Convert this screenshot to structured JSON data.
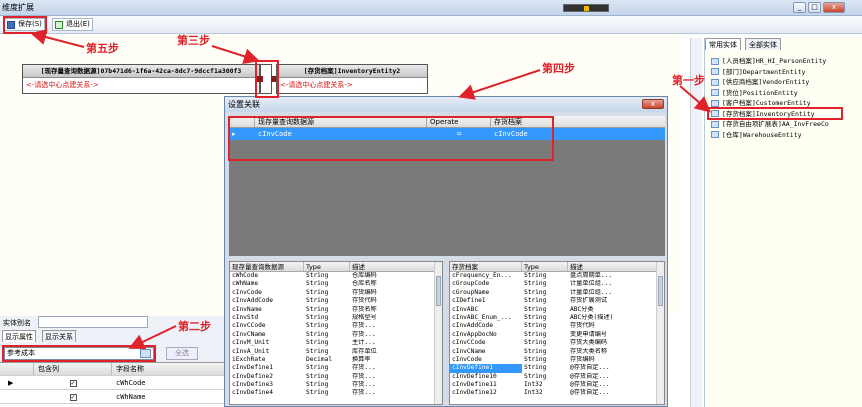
{
  "window": {
    "title": "维度扩展",
    "min": "_",
    "max": "□",
    "close": "x"
  },
  "toolbar": {
    "save_label": "保存(S)",
    "exit_label": "退出(E)"
  },
  "canvas": {
    "entity1": {
      "title": "[现存量查询数据源]07b471d6-1f6a-42ca-8dc7-9dccf1a300f3",
      "hint": "<-请选中心点建关系->"
    },
    "entity2": {
      "title": "[存货档案]InventoryEntity2",
      "hint": "<-请选中心点建关系->"
    }
  },
  "dialog": {
    "title": "设置关联",
    "close": "x",
    "relation_headers": [
      "现存量查询数据源",
      "Operate",
      "存货档案"
    ],
    "relation_row": {
      "left": "cInvCode",
      "op": "=",
      "right": "cInvCode"
    },
    "left_list": {
      "headers": [
        "现存量查询数据源",
        "Type",
        "描述"
      ],
      "rows": [
        [
          "cWhCode",
          "String",
          "仓库编码"
        ],
        [
          "cWhName",
          "String",
          "仓库名称"
        ],
        [
          "cInvCode",
          "String",
          "存货编码"
        ],
        [
          "cInvAddCode",
          "String",
          "存货代码"
        ],
        [
          "cInvName",
          "String",
          "存货名称"
        ],
        [
          "cInvStd",
          "String",
          "规格型号"
        ],
        [
          "cInvCCode",
          "String",
          "存货..."
        ],
        [
          "cInvCName",
          "String",
          "存货..."
        ],
        [
          "cInvM_Unit",
          "String",
          "主计..."
        ],
        [
          "cInvA_Unit",
          "String",
          "库存单位"
        ],
        [
          "iExchRate",
          "Decimal",
          "换算率"
        ],
        [
          "cInvDefine1",
          "String",
          "存货..."
        ],
        [
          "cInvDefine2",
          "String",
          "存货..."
        ],
        [
          "cInvDefine3",
          "String",
          "存货..."
        ],
        [
          "cInvDefine4",
          "String",
          "存货..."
        ]
      ]
    },
    "right_list": {
      "headers": [
        "存货档案",
        "Type",
        "描述"
      ],
      "selected_index": 11,
      "rows": [
        [
          "cFrequency_En...",
          "String",
          "盘点周期单..."
        ],
        [
          "cGroupCode",
          "String",
          "计量单位组..."
        ],
        [
          "cGroupName",
          "String",
          "计量单位组..."
        ],
        [
          "cIDefine1",
          "String",
          "存货扩展测试"
        ],
        [
          "cInvABC",
          "String",
          "ABC分类"
        ],
        [
          "cInvABC_Enum_...",
          "String",
          "ABC分类(描述)"
        ],
        [
          "cInvAddCode",
          "String",
          "存货代码"
        ],
        [
          "cInvAppDocNo",
          "String",
          "变更申请编号"
        ],
        [
          "cInvCCode",
          "String",
          "存货大类编码"
        ],
        [
          "cInvCName",
          "String",
          "存货大类名称"
        ],
        [
          "cInvCode",
          "String",
          "存货编码"
        ],
        [
          "cInvDefine1",
          "String",
          "@存货自定..."
        ],
        [
          "cInvDefine10",
          "String",
          "@存货自定..."
        ],
        [
          "cInvDefine11",
          "Int32",
          "@存货自定..."
        ],
        [
          "cInvDefine12",
          "Int32",
          "@存货自定..."
        ]
      ]
    }
  },
  "right_panel": {
    "tabs": [
      "常用实体",
      "全部实体"
    ],
    "items": [
      "[人员档案]HR_HI_PersonEntity",
      "[部门]DepartmentEntity",
      "[供应商档案]VendorEntity",
      "[货位]PositionEntity",
      "[客户档案]CustomerEntity",
      "[存货档案]InventoryEntity",
      "[存货自由项扩展表]AA_InvFreeCo",
      "[仓库]WarehouseEntity"
    ],
    "highlight_index": 5
  },
  "bottom_left": {
    "alias_label": "实体别名",
    "tabs": [
      "显示属性",
      "显示关系"
    ],
    "filter_value": "参考成本",
    "select_all": "全选",
    "grid_headers": [
      "包含列",
      "字段名称"
    ],
    "grid_rows": [
      [
        "✓",
        "cWhCode"
      ],
      [
        "✓",
        "cWhName"
      ]
    ]
  },
  "annotations": {
    "step1": "第一步",
    "step2": "第二步",
    "step3": "第三步",
    "step4": "第四步",
    "step5": "第五步"
  },
  "colors": {
    "annotation": "#e0222a",
    "selection": "#3399ff"
  }
}
